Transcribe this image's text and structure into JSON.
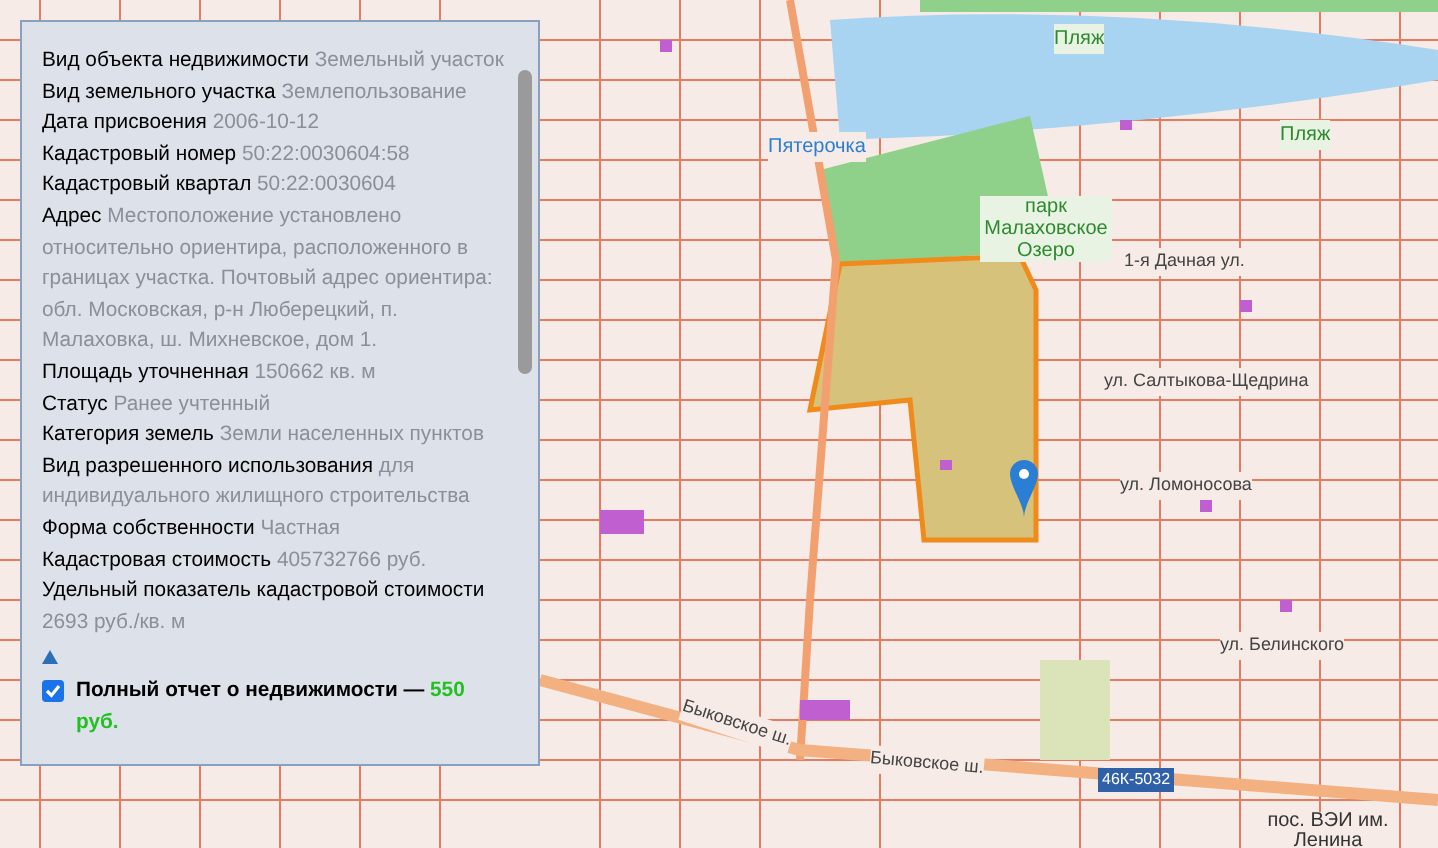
{
  "info_panel": {
    "fields": [
      {
        "label": "Вид объекта недвижимости",
        "value": "Земельный участок"
      },
      {
        "label": "Вид земельного участка",
        "value": "Землепользование"
      },
      {
        "label": "Дата присвоения",
        "value": "2006-10-12"
      },
      {
        "label": "Кадастровый номер",
        "value": "50:22:0030604:58"
      },
      {
        "label": "Кадастровый квартал",
        "value": "50:22:0030604"
      },
      {
        "label": "Адрес",
        "value": "Местоположение установлено относительно ориентира, расположенного в границах участка. Почтовый адрес ориентира: обл. Московская, р-н Люберецкий, п. Малаховка, ш. Михневское, дом 1."
      },
      {
        "label": "Площадь уточненная",
        "value": "150662 кв. м"
      },
      {
        "label": "Статус",
        "value": "Ранее учтенный"
      },
      {
        "label": "Категория земель",
        "value": "Земли населенных пунктов"
      },
      {
        "label": "Вид разрешенного использования",
        "value": "для индивидуального жилищного строительства"
      },
      {
        "label": "Форма собственности",
        "value": "Частная"
      },
      {
        "label": "Кадастровая стоимость",
        "value": "405732766 руб."
      },
      {
        "label": "Удельный показатель кадастровой стоимости",
        "value": "2693 руб./кв. м"
      }
    ],
    "report": {
      "checked": true,
      "label": "Полный отчет о недвижимости — ",
      "price": "550 руб."
    }
  },
  "map": {
    "labels": [
      {
        "text": "Пляж",
        "kind": "poi"
      },
      {
        "text": "Пляж",
        "kind": "poi"
      },
      {
        "text": "Пятерочка",
        "kind": "shop"
      },
      {
        "text": "парк Малаховское Озеро",
        "kind": "poi"
      },
      {
        "text": "1-я Дачная ул.",
        "kind": "street"
      },
      {
        "text": "ул. Салтыкова-Щедрина",
        "kind": "street"
      },
      {
        "text": "ул. Ломоносова",
        "kind": "street"
      },
      {
        "text": "ул. Белинского",
        "kind": "street"
      },
      {
        "text": "Быковское ш.",
        "kind": "street"
      },
      {
        "text": "Быковское ш.",
        "kind": "street"
      },
      {
        "text": "46К-5032",
        "kind": "route"
      },
      {
        "text": "пос. ВЭИ им. Ленина",
        "kind": "place"
      }
    ]
  }
}
